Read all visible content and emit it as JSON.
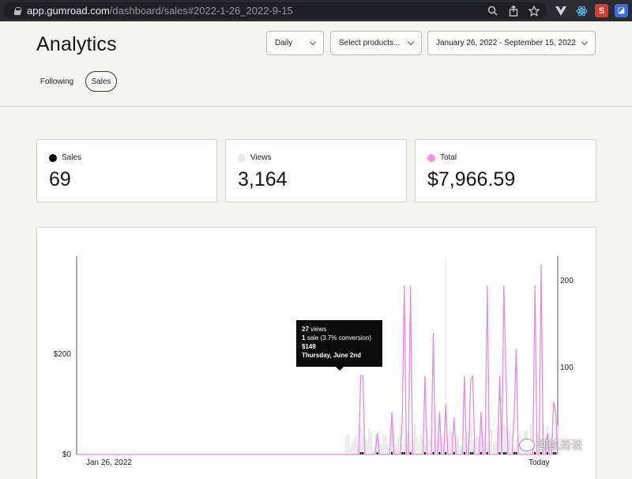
{
  "browser": {
    "url_host": "app.gumroad.com",
    "url_path": "/dashboard/sales#2022-1-26_2022-9-15"
  },
  "header": {
    "title": "Analytics",
    "tabs": [
      {
        "label": "Following",
        "active": false
      },
      {
        "label": "Sales",
        "active": true
      }
    ],
    "filters": {
      "interval": "Daily",
      "products_placeholder": "Select products...",
      "date_range": "January 26, 2022 - September 15, 2022"
    }
  },
  "stats": [
    {
      "label": "Sales",
      "value": "69",
      "color": "#000000"
    },
    {
      "label": "Views",
      "value": "3,164",
      "color": "#e6e6e6"
    },
    {
      "label": "Total",
      "value": "$7,966.59",
      "color": "#ee92e0"
    }
  ],
  "tooltip": {
    "views_count": "27",
    "views_word": "views",
    "sales_count": "1",
    "sales_text": "sale (3.7% conversion)",
    "amount": "$149",
    "date": "Thursday, June 2nd"
  },
  "watermark": "凯凯而谈",
  "chart_data": {
    "type": "line",
    "x_start_label": "Jan 26, 2022",
    "x_end_label": "Today",
    "y_left": {
      "ticks": [
        "$0",
        "$200"
      ],
      "tick_values": [
        0,
        200
      ],
      "range": [
        0,
        380
      ]
    },
    "y_right": {
      "ticks": [
        "100",
        "200"
      ],
      "tick_values": [
        100,
        200
      ],
      "range": [
        0,
        230
      ]
    },
    "days": 233,
    "series": [
      {
        "role": "total",
        "color": "#e48bdc",
        "values": [
          0,
          0,
          0,
          0,
          0,
          0,
          0,
          0,
          0,
          0,
          0,
          0,
          0,
          0,
          0,
          0,
          0,
          0,
          0,
          0,
          0,
          0,
          0,
          0,
          0,
          0,
          0,
          0,
          0,
          0,
          0,
          0,
          0,
          0,
          0,
          0,
          0,
          0,
          0,
          0,
          0,
          0,
          0,
          0,
          0,
          0,
          0,
          0,
          0,
          0,
          0,
          0,
          0,
          0,
          0,
          0,
          0,
          0,
          0,
          0,
          0,
          0,
          0,
          0,
          0,
          0,
          0,
          0,
          0,
          0,
          0,
          0,
          0,
          0,
          0,
          0,
          0,
          0,
          0,
          0,
          0,
          0,
          0,
          0,
          0,
          0,
          0,
          0,
          0,
          0,
          0,
          0,
          0,
          0,
          0,
          0,
          0,
          0,
          0,
          0,
          0,
          0,
          0,
          0,
          0,
          0,
          0,
          0,
          0,
          0,
          0,
          0,
          0,
          0,
          0,
          0,
          0,
          0,
          0,
          0,
          0,
          0,
          0,
          0,
          0,
          0,
          0,
          0,
          0,
          0,
          0,
          0,
          0,
          0,
          0,
          0,
          0,
          149,
          149,
          0,
          0,
          0,
          0,
          0,
          0,
          40,
          0,
          0,
          0,
          0,
          0,
          0,
          80,
          0,
          0,
          0,
          0,
          60,
          0,
          0,
          0,
          0,
          0,
          0,
          0,
          0,
          0,
          0,
          149,
          0,
          0,
          0,
          0,
          0,
          0,
          80,
          0,
          0,
          149,
          0,
          0,
          0,
          70,
          0,
          0,
          0,
          0,
          149,
          0,
          0,
          0,
          149,
          0,
          0,
          0,
          80,
          0,
          0,
          0,
          0,
          0,
          0,
          0,
          0,
          149,
          0,
          0,
          149,
          0,
          0,
          0,
          80,
          0,
          0,
          0,
          0,
          0,
          0,
          0,
          0,
          0,
          60,
          0,
          0,
          0,
          0,
          0,
          40,
          0,
          0,
          0,
          80,
          0,
          0,
          40,
          0,
          0,
          0,
          0,
          0
        ]
      },
      {
        "role": "total_peaks_late",
        "color": "#e48bdc",
        "values": [
          0,
          0,
          0,
          0,
          0,
          0,
          0,
          0,
          0,
          0,
          0,
          0,
          0,
          0,
          0,
          0,
          0,
          0,
          0,
          0,
          0,
          0,
          0,
          0,
          0,
          0,
          0,
          0,
          0,
          0,
          0,
          0,
          0,
          0,
          0,
          0,
          0,
          0,
          0,
          0,
          0,
          0,
          0,
          0,
          0,
          0,
          0,
          0,
          0,
          0,
          0,
          0,
          0,
          0,
          0,
          0,
          0,
          0,
          0,
          0,
          0,
          0,
          0,
          0,
          0,
          0,
          0,
          0,
          0,
          0,
          0,
          0,
          0,
          0,
          0,
          0,
          0,
          0,
          0,
          0,
          0,
          0,
          0,
          0,
          0,
          0,
          0,
          0,
          0,
          0,
          0,
          0,
          0,
          0,
          0,
          0,
          0,
          0,
          0,
          0,
          0,
          0,
          0,
          0,
          0,
          0,
          0,
          0,
          0,
          0,
          0,
          0,
          0,
          0,
          0,
          0,
          0,
          0,
          0,
          0,
          0,
          0,
          0,
          0,
          0,
          0,
          0,
          0,
          0,
          0,
          0,
          0,
          0,
          0,
          0,
          0,
          0,
          0,
          0,
          0,
          0,
          0,
          0,
          0,
          0,
          0,
          0,
          0,
          0,
          0,
          0,
          0,
          0,
          0,
          0,
          0,
          0,
          0,
          0,
          0,
          0,
          0,
          0,
          0,
          0,
          0,
          0,
          0,
          0,
          0,
          0,
          0,
          0,
          0,
          0,
          0,
          0,
          0,
          0,
          0,
          0,
          0,
          0,
          0,
          0,
          0,
          0,
          0,
          0,
          0,
          0,
          0,
          0,
          0,
          0,
          0,
          0,
          0,
          0,
          0,
          0,
          0,
          0,
          0,
          0,
          0,
          0,
          0,
          0,
          0,
          0,
          0,
          0,
          0,
          0,
          0,
          0,
          0,
          0,
          0,
          0,
          0,
          0,
          0,
          0,
          0,
          0,
          0,
          0,
          0,
          0,
          0,
          0
        ]
      }
    ],
    "peaks": [
      {
        "day": 137,
        "value": 149
      },
      {
        "day": 158,
        "value": 320
      },
      {
        "day": 161,
        "value": 320
      },
      {
        "day": 172,
        "value": 230
      },
      {
        "day": 178,
        "value": 95
      },
      {
        "day": 190,
        "value": 140
      },
      {
        "day": 198,
        "value": 320
      },
      {
        "day": 206,
        "value": 320
      },
      {
        "day": 212,
        "value": 200
      },
      {
        "day": 221,
        "value": 320
      },
      {
        "day": 224,
        "value": 360
      },
      {
        "day": 230,
        "value": 100
      }
    ]
  }
}
